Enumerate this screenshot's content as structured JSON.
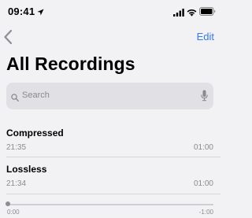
{
  "status_bar": {
    "time": "09:41",
    "icons": [
      "location-arrow-icon",
      "cellular-signal-icon",
      "wifi-icon",
      "battery-icon"
    ]
  },
  "nav": {
    "back_icon": "chevron-left-icon",
    "edit_label": "Edit"
  },
  "page_title": "All Recordings",
  "search": {
    "placeholder": "Search",
    "icons": [
      "magnifying-glass-icon",
      "microphone-icon"
    ]
  },
  "recordings": [
    {
      "title": "Compressed",
      "time": "21:35",
      "duration": "01:00"
    },
    {
      "title": "Lossless",
      "time": "21:34",
      "duration": "01:00"
    }
  ],
  "player": {
    "elapsed": "0:00",
    "remaining": "-1:00",
    "progress": 0
  },
  "colors": {
    "accent": "#3478f6",
    "background": "#f2f2f4",
    "secondary_text": "#8a8a8e"
  }
}
